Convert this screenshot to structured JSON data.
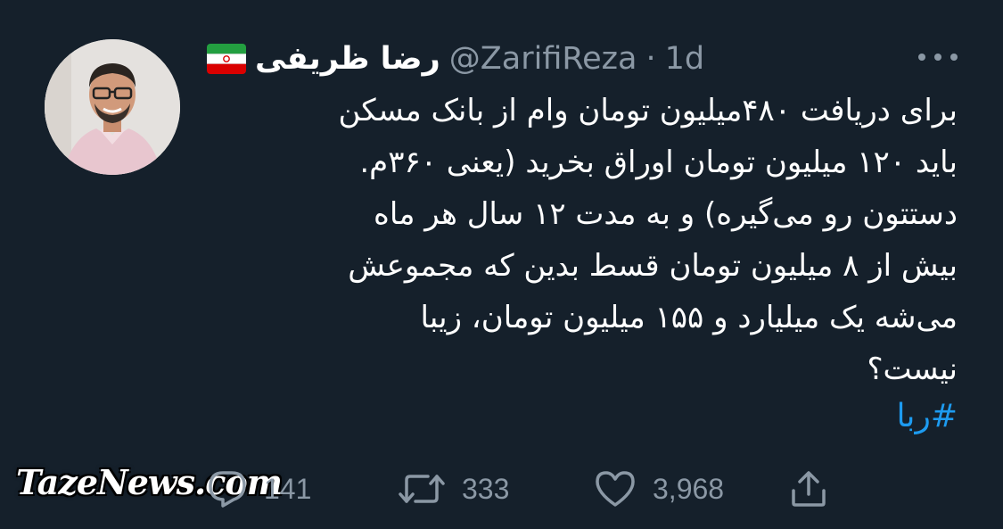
{
  "tweet": {
    "display_name": "رضا ظریفی",
    "handle": "@ZarifiReza",
    "separator": "·",
    "time": "1d",
    "lines": [
      "برای دریافت ۴۸۰میلیون تومان وام از بانک مسکن",
      "باید ۱۲۰ میلیون تومان اوراق بخرید (یعنی ۳۶۰م.",
      "دستتون رو می‌گیره) و به مدت ۱۲ سال هر ماه",
      "بیش از ۸ میلیون تومان قسط بدین که مجموعش",
      "می‌شه یک میلیارد و ۱۵۵ میلیون تومان، زیبا",
      "نیست؟"
    ],
    "hashtag": "#ربا"
  },
  "actions": {
    "reply_count": "141",
    "retweet_count": "333",
    "like_count": "3,968"
  },
  "watermark": "TazeNews.com",
  "colors": {
    "background": "#15202b",
    "text": "#ffffff",
    "secondary": "#8b98a5",
    "accent": "#1d9bf0"
  },
  "icons": {
    "flag": "iran-flag-icon",
    "more": "more-icon",
    "reply": "reply-icon",
    "retweet": "retweet-icon",
    "like": "like-icon",
    "share": "share-icon"
  }
}
